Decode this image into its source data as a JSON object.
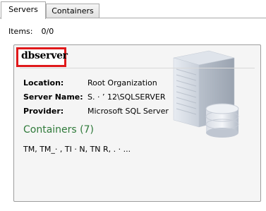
{
  "tabs": [
    {
      "label": "Servers"
    },
    {
      "label": "Containers"
    }
  ],
  "items": {
    "label": "Items:",
    "count": "0/0"
  },
  "card": {
    "title": "dbserver",
    "properties": [
      {
        "key": "Location:",
        "value": "Root Organization"
      },
      {
        "key": "Server Name:",
        "value": "S.    ·  ’     12\\SQLSERVER"
      },
      {
        "key": "Provider:",
        "value": "Microsoft SQL Server"
      }
    ],
    "containers_heading": "Containers (7)",
    "containers_list": "TM, TM_·  , TI · N, TN   R, .  ·  ...",
    "server_icon": "database-server-icon",
    "highlight_color": "#e0191b"
  }
}
